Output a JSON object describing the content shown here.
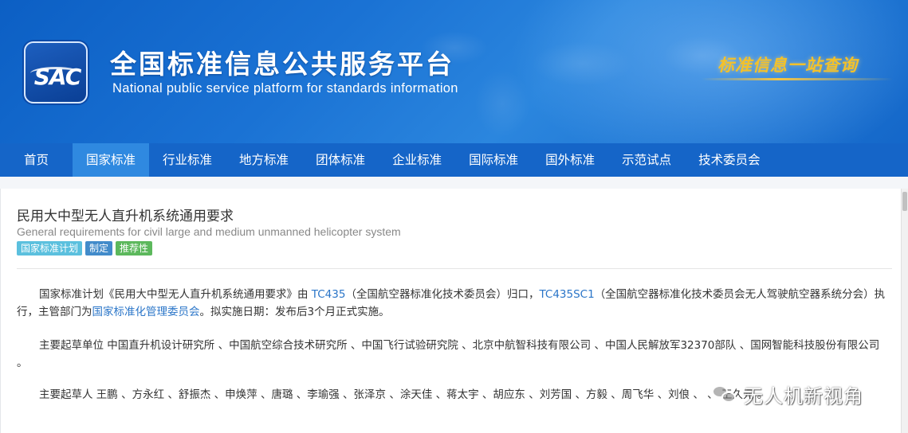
{
  "header": {
    "logo_text": "SAC",
    "title": "全国标准信息公共服务平台",
    "subtitle": "National public service platform  for standards information",
    "slogan": "标准信息一站查询"
  },
  "nav": {
    "items": [
      {
        "label": "首页",
        "active": false
      },
      {
        "label": "国家标准",
        "active": true
      },
      {
        "label": "行业标准",
        "active": false
      },
      {
        "label": "地方标准",
        "active": false
      },
      {
        "label": "团体标准",
        "active": false
      },
      {
        "label": "企业标准",
        "active": false
      },
      {
        "label": "国际标准",
        "active": false
      },
      {
        "label": "国外标准",
        "active": false
      },
      {
        "label": "示范试点",
        "active": false
      },
      {
        "label": "技术委员会",
        "active": false
      }
    ]
  },
  "standard": {
    "title": "民用大中型无人直升机系统通用要求",
    "title_en": "General requirements for civil large and medium unmanned helicopter system",
    "tags": {
      "plan": "国家标准计划",
      "make": "制定",
      "recommended": "推荐性"
    },
    "para1": {
      "a": "国家标准计划《民用大中型无人直升机系统通用要求》由 ",
      "tc": "TC435",
      "b": "（全国航空器标准化技术委员会）归口，",
      "sc": "TC435SC1",
      "c": "（全国航空器标准化技术委员会无人驾驶航空器系统分会）执行，主管部门为",
      "dept": "国家标准化管理委员会",
      "d": "。拟实施日期：发布后3个月正式实施。"
    },
    "para2": "主要起草单位 中国直升机设计研究所 、中国航空综合技术研究所 、中国飞行试验研究院 、北京中航智科技有限公司 、中国人民解放军32370部队 、国网智能科技股份有限公司 。",
    "para3": "主要起草人 王鹏 、方永红 、舒振杰 、申焕萍 、唐璐 、李瑜强 、张泽京 、涂天佳 、蒋太宇 、胡应东 、刘芳国 、方毅 、周飞华 、刘俍 、 、 王久元 。"
  },
  "watermark": {
    "icon": "wechat-icon",
    "text": "无人机新视角"
  }
}
